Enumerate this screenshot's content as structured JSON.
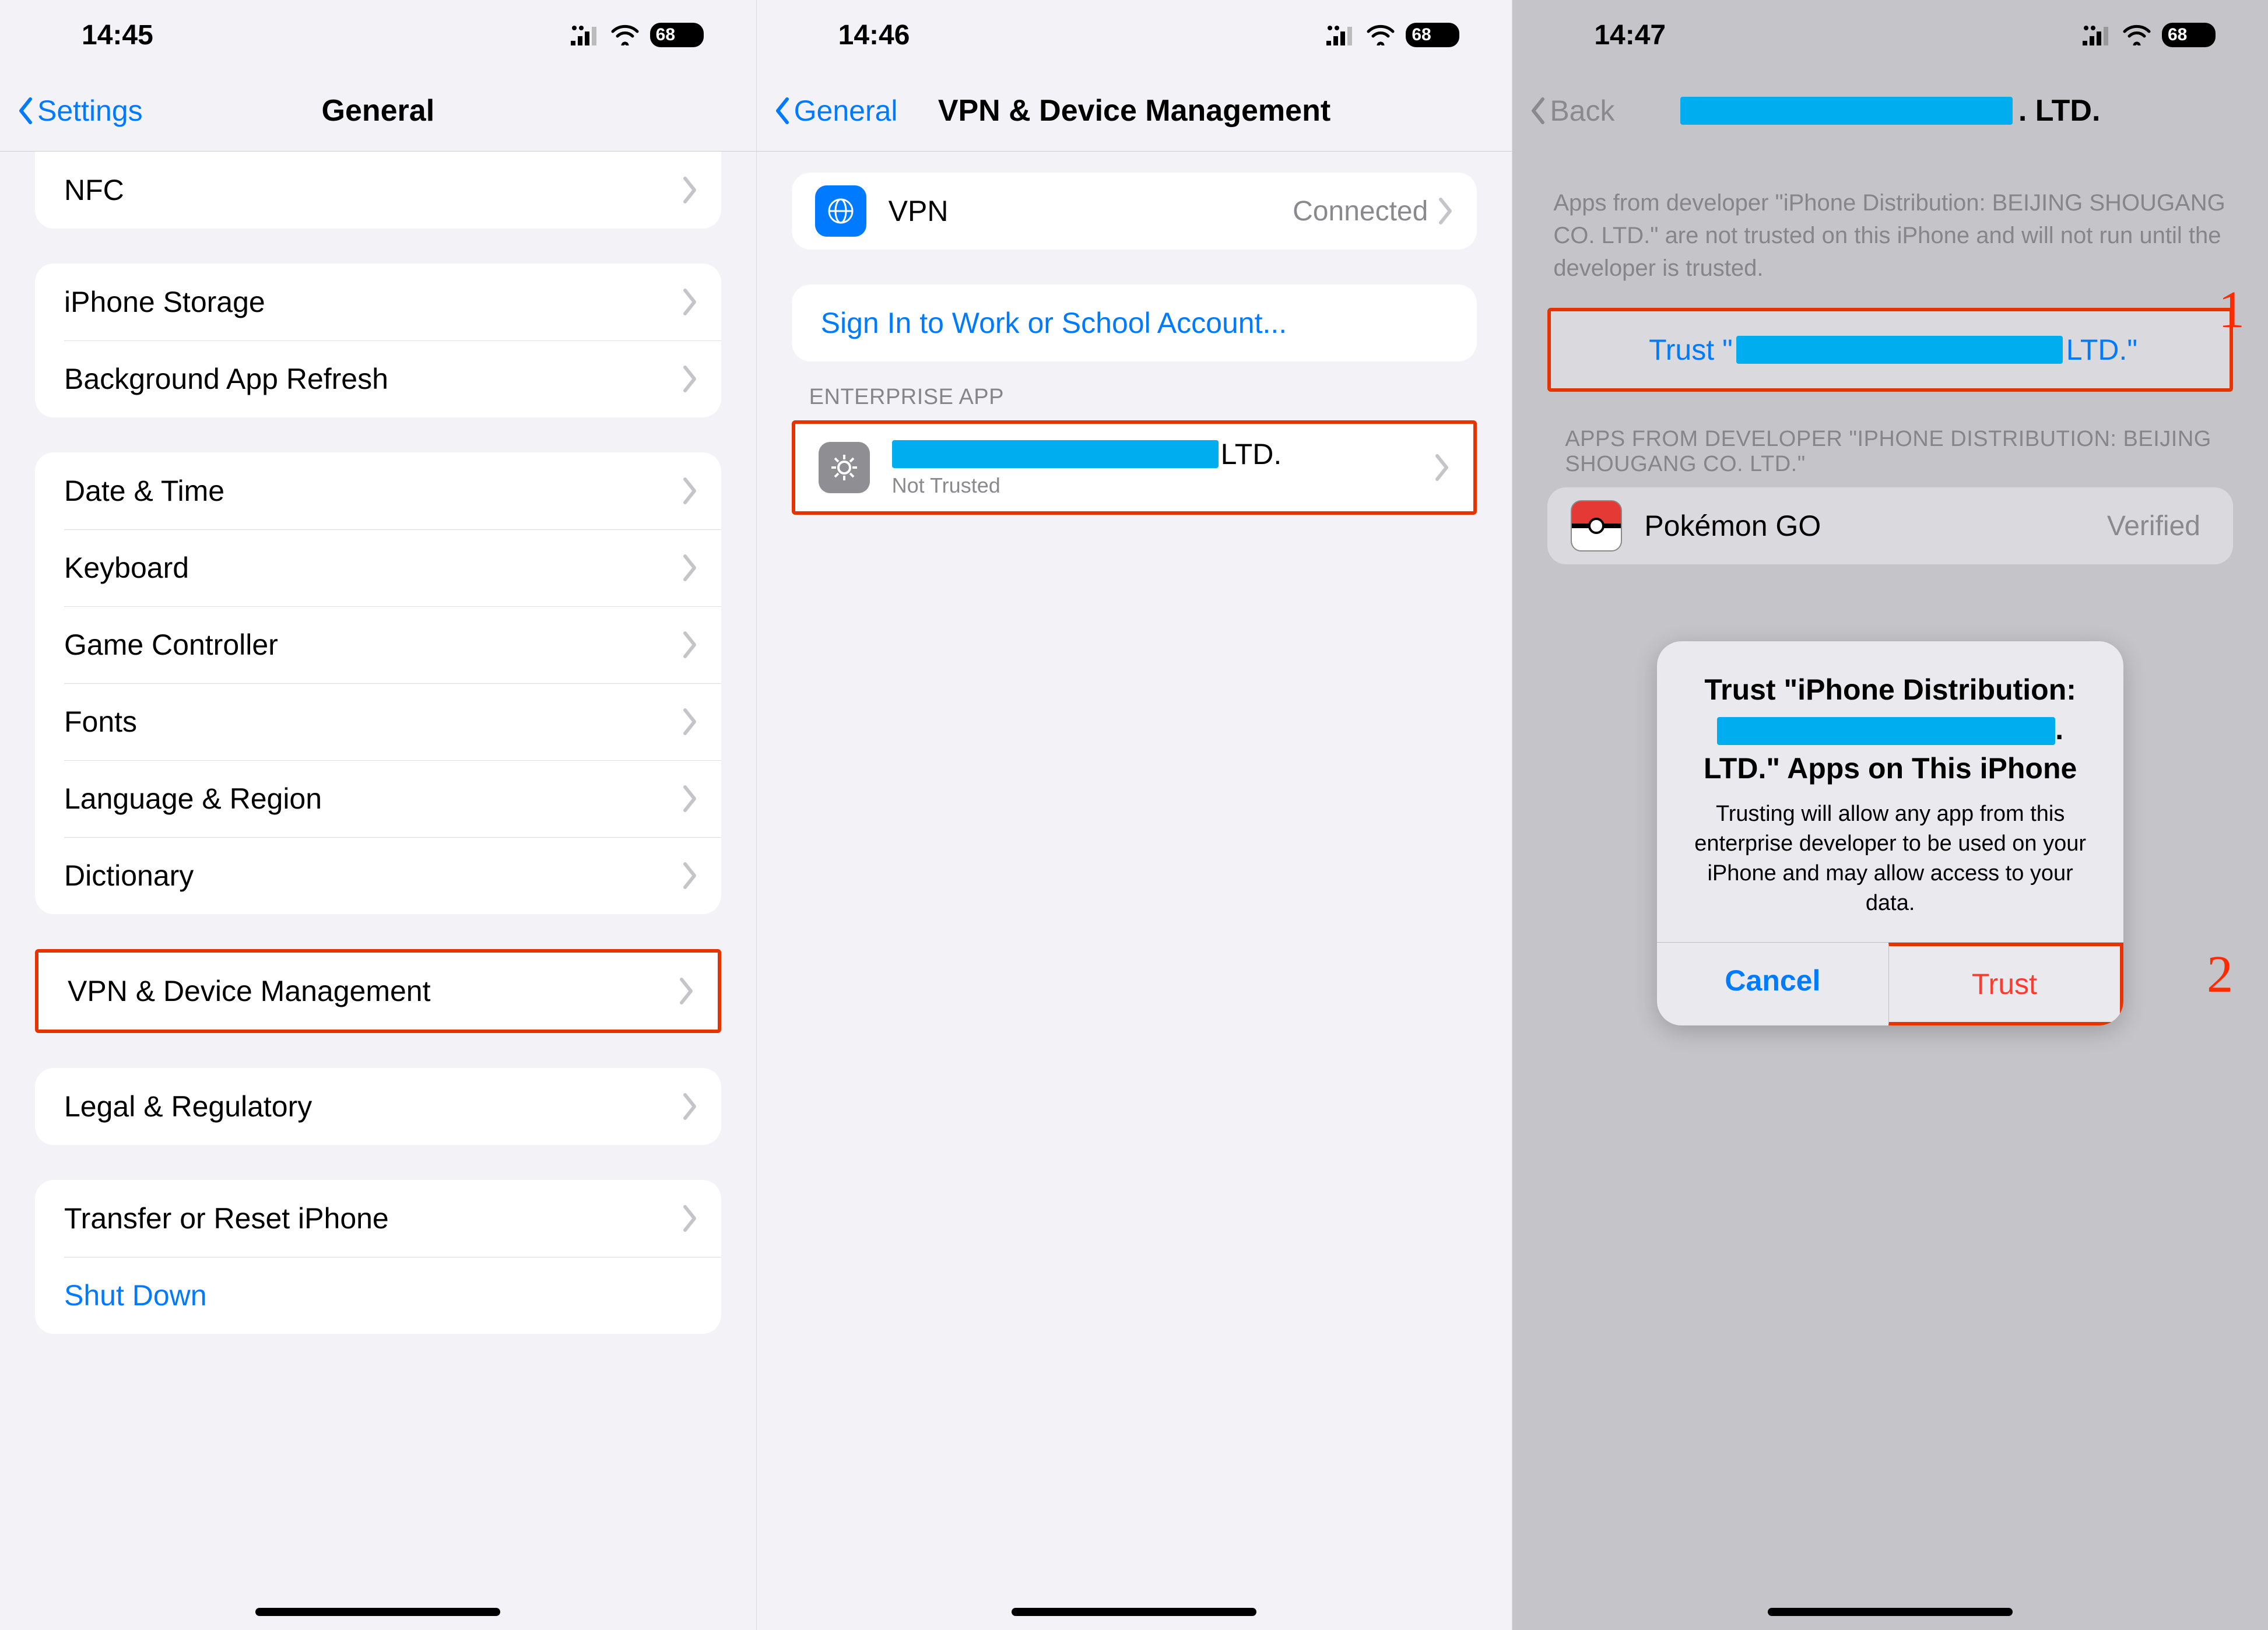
{
  "status": {
    "battery": "68"
  },
  "phone1": {
    "time": "14:45",
    "back": "Settings",
    "title": "General",
    "rows": {
      "nfc": "NFC",
      "iphone_storage": "iPhone Storage",
      "background_refresh": "Background App Refresh",
      "date_time": "Date & Time",
      "keyboard": "Keyboard",
      "game_controller": "Game Controller",
      "fonts": "Fonts",
      "language_region": "Language & Region",
      "dictionary": "Dictionary",
      "vpn_device_mgmt": "VPN & Device Management",
      "legal": "Legal & Regulatory",
      "transfer_reset": "Transfer or Reset iPhone",
      "shut_down": "Shut Down"
    }
  },
  "phone2": {
    "time": "14:46",
    "back": "General",
    "title": "VPN & Device Management",
    "vpn_label": "VPN",
    "vpn_value": "Connected",
    "sign_in": "Sign In to Work or School Account...",
    "section_header": "ENTERPRISE APP",
    "profile_suffix": " LTD.",
    "profile_status": "Not Trusted"
  },
  "phone3": {
    "time": "14:47",
    "back": "Back",
    "title_suffix": ". LTD.",
    "footer": "Apps from developer \"iPhone Distribution: BEIJING SHOUGANG CO. LTD.\" are not trusted on this iPhone and will not run until the developer is trusted.",
    "trust_prefix": "Trust \"",
    "trust_suffix": " LTD.\"",
    "apps_header": "APPS FROM DEVELOPER \"IPHONE DISTRIBUTION: BEIJING SHOUGANG CO. LTD.\"",
    "app_name": "Pokémon GO",
    "app_status": "Verified",
    "dialog": {
      "title_line1": "Trust \"iPhone Distribution:",
      "title_line3": "LTD.\" Apps on This iPhone",
      "message": "Trusting will allow any app from this enterprise developer to be used on your iPhone and may allow access to your data.",
      "cancel": "Cancel",
      "trust": "Trust"
    },
    "annot1": "1",
    "annot2": "2"
  }
}
